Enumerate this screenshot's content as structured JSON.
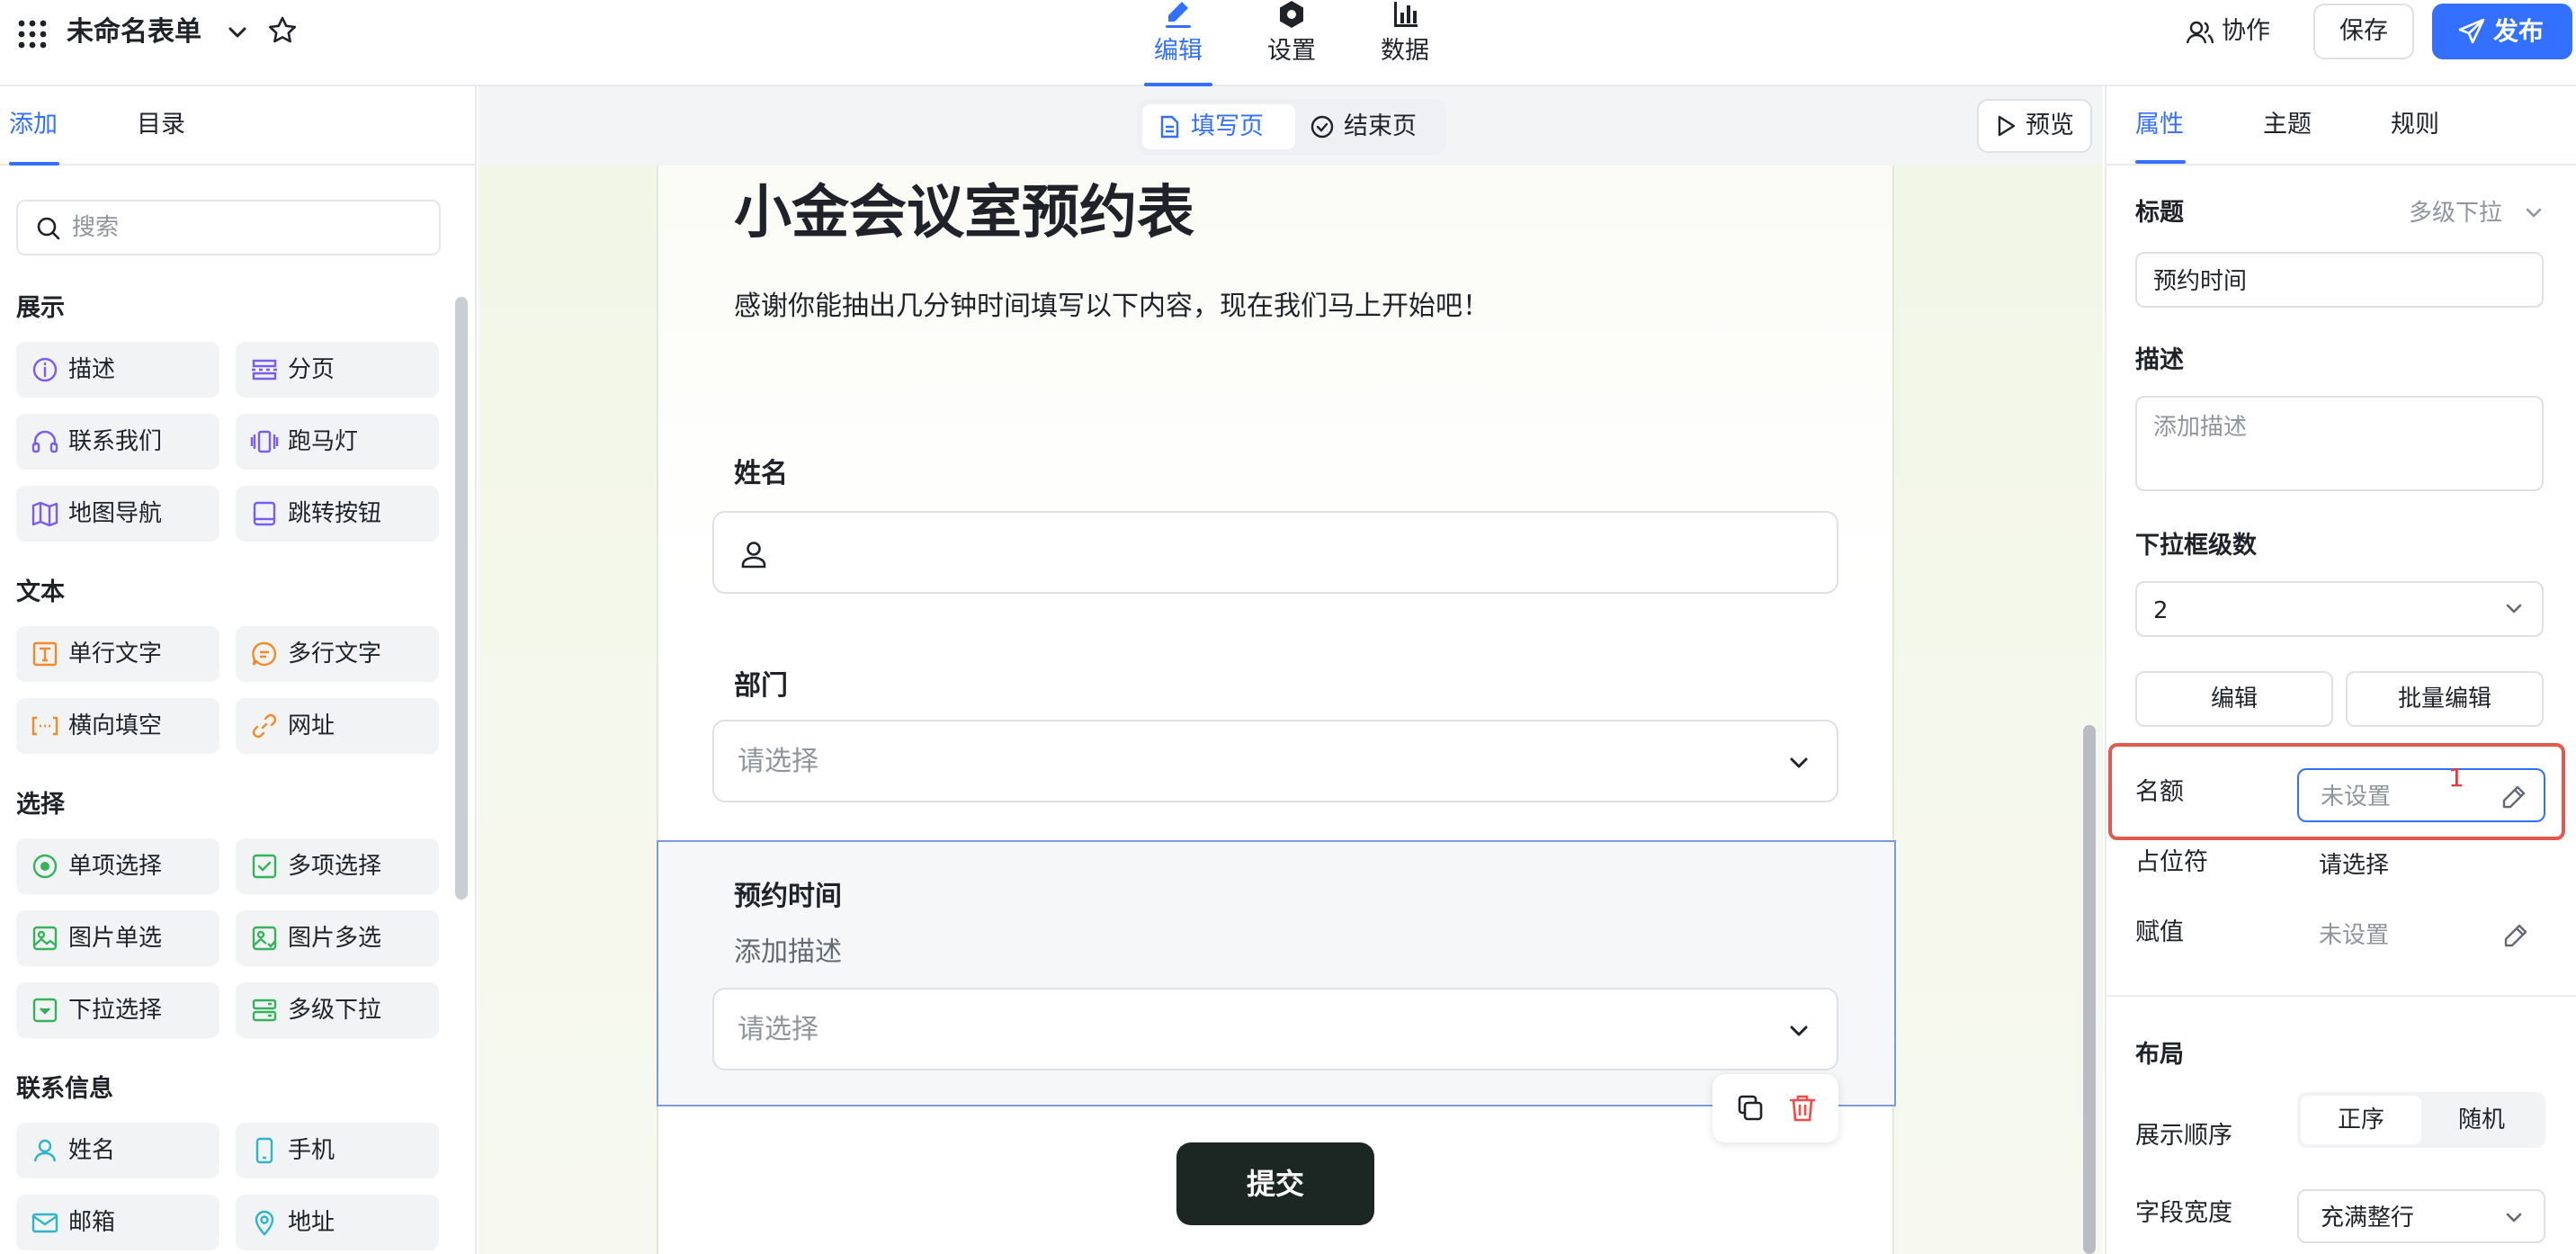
{
  "header": {
    "form_title": "未命名表单",
    "mode_tabs": [
      {
        "label": "编辑",
        "icon": "pencil-icon",
        "active": true
      },
      {
        "label": "设置",
        "icon": "gear-icon",
        "active": false
      },
      {
        "label": "数据",
        "icon": "bar-chart-icon",
        "active": false
      }
    ],
    "collab_label": "协作",
    "save_label": "保存",
    "publish_label": "发布"
  },
  "left_panel": {
    "tabs": [
      {
        "label": "添加",
        "active": true
      },
      {
        "label": "目录",
        "active": false
      }
    ],
    "search_placeholder": "搜索",
    "categories": [
      {
        "title": "展示",
        "items": [
          {
            "label": "描述",
            "icon": "info-circle-icon"
          },
          {
            "label": "分页",
            "icon": "page-break-icon"
          },
          {
            "label": "联系我们",
            "icon": "headset-icon"
          },
          {
            "label": "跑马灯",
            "icon": "carousel-icon"
          },
          {
            "label": "地图导航",
            "icon": "map-icon"
          },
          {
            "label": "跳转按钮",
            "icon": "button-icon"
          }
        ]
      },
      {
        "title": "文本",
        "items": [
          {
            "label": "单行文字",
            "icon": "text-field-icon"
          },
          {
            "label": "多行文字",
            "icon": "textarea-icon"
          },
          {
            "label": "横向填空",
            "icon": "inline-blank-icon"
          },
          {
            "label": "网址",
            "icon": "link-icon"
          }
        ]
      },
      {
        "title": "选择",
        "items": [
          {
            "label": "单项选择",
            "icon": "radio-icon"
          },
          {
            "label": "多项选择",
            "icon": "checkbox-icon"
          },
          {
            "label": "图片单选",
            "icon": "image-radio-icon"
          },
          {
            "label": "图片多选",
            "icon": "image-checkbox-icon"
          },
          {
            "label": "下拉选择",
            "icon": "dropdown-icon"
          },
          {
            "label": "多级下拉",
            "icon": "cascade-dropdown-icon"
          }
        ]
      },
      {
        "title": "联系信息",
        "items": [
          {
            "label": "姓名",
            "icon": "person-icon"
          },
          {
            "label": "手机",
            "icon": "phone-icon"
          },
          {
            "label": "邮箱",
            "icon": "mail-icon"
          },
          {
            "label": "地址",
            "icon": "location-pin-icon"
          }
        ]
      }
    ]
  },
  "canvas": {
    "page_switch": [
      {
        "label": "填写页",
        "icon": "document-icon",
        "active": true
      },
      {
        "label": "结束页",
        "icon": "check-circle-icon",
        "active": false
      }
    ],
    "preview_label": "预览",
    "form": {
      "heading": "小金会议室预约表",
      "subtitle": "感谢你能抽出几分钟时间填写以下内容，现在我们马上开始吧！",
      "fields": [
        {
          "label": "姓名",
          "type": "input",
          "icon": "person-icon"
        },
        {
          "label": "部门",
          "type": "select",
          "placeholder": "请选择"
        },
        {
          "label": "预约时间",
          "type": "select",
          "placeholder": "请选择",
          "description": "添加描述",
          "selected": true
        }
      ],
      "submit_label": "提交"
    }
  },
  "right_panel": {
    "tabs": [
      {
        "label": "属性",
        "active": true
      },
      {
        "label": "主题",
        "active": false
      },
      {
        "label": "规则",
        "active": false
      }
    ],
    "title_label": "标题",
    "field_type": "多级下拉",
    "title_value": "预约时间",
    "desc_label": "描述",
    "desc_placeholder": "添加描述",
    "levels_label": "下拉框级数",
    "levels_value": "2",
    "edit_btn": "编辑",
    "batch_edit_btn": "批量编辑",
    "quota_label": "名额",
    "quota_value": "未设置",
    "annotation_number": "1",
    "placeholder_label": "占位符",
    "placeholder_value": "请选择",
    "assign_label": "赋值",
    "assign_value": "未设置",
    "layout_label": "布局",
    "order_label": "展示顺序",
    "order_options": [
      {
        "label": "正序",
        "active": true
      },
      {
        "label": "随机",
        "active": false
      }
    ],
    "width_label": "字段宽度",
    "width_value": "充满整行"
  },
  "colors": {
    "accent": "#3370ff",
    "annotation_red": "#e05a4f",
    "submit_button": "#1c2724",
    "delete_red": "#f54a45"
  }
}
